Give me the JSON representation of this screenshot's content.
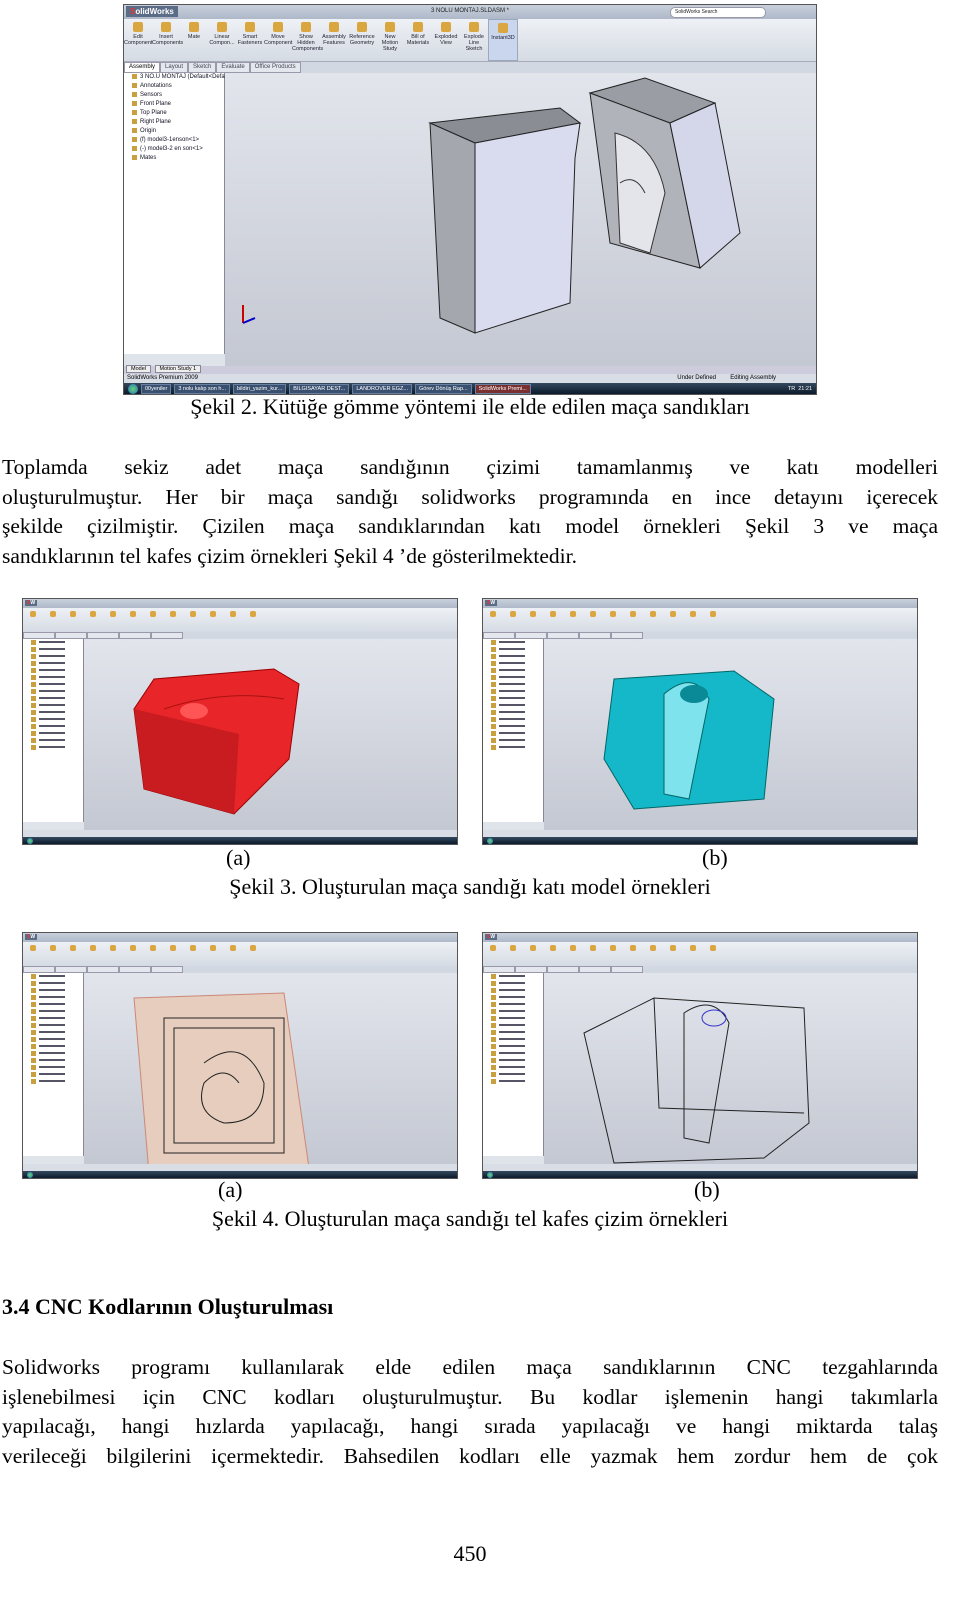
{
  "figure2": {
    "window": {
      "app_logo": "SolidWorks",
      "title": "3 NOLU MONTAJ.SLDASM *",
      "search_placeholder": "SolidWorks Search",
      "ribbon": [
        "Edit Component",
        "Insert Components",
        "Mate",
        "Linear Compon...",
        "Smart Fasteners",
        "Move Component",
        "Show Hidden Components",
        "Assembly Features",
        "Reference Geometry",
        "New Motion Study",
        "Bill of Materials",
        "Exploded View",
        "Explode Line Sketch",
        "Instant3D"
      ],
      "tabs": [
        "Assembly",
        "Layout",
        "Sketch",
        "Evaluate",
        "Office Products"
      ],
      "tree": [
        "3 NO.U MONTAJ  (Default<Defa",
        "Annotations",
        "Sensors",
        "Front Plane",
        "Top Plane",
        "Right Plane",
        "Origin",
        "(f) model3-1enson<1>",
        "(-) model3-2 en son<1>",
        "Mates"
      ],
      "bottom_tabs": [
        "Model",
        "Motion Study 1"
      ],
      "status_left": "SolidWorks Premium 2009",
      "status_right": [
        "Under Defined",
        "Editing Assembly"
      ],
      "taskbar": [
        "00yeniler",
        "3 nolu kalıp son h...",
        "bildiri_yazim_kur...",
        "BILGISAYAR DEST...",
        "LANDROVER EGZ...",
        "Görev Dönüş Rap...",
        "SolidWorks Premi..."
      ],
      "tray_lang": "TR",
      "clock": "21:21"
    },
    "caption": "Şekil 2. Kütüğe gömme yöntemi ile elde edilen maça sandıkları"
  },
  "paragraph1": {
    "lines": [
      "Toplamda sekiz adet maça sandığının çizimi tamamlanmış ve katı modelleri",
      "oluşturulmuştur. Her bir maça sandığı solidworks programında en ince detayını içerecek",
      "şekilde çizilmiştir. Çizilen maça sandıklarından katı model örnekleri Şekil 3 ve maça"
    ],
    "last_line": "sandıklarının tel kafes çizim örnekleri Şekil 4 ’de gösterilmektedir."
  },
  "figure3": {
    "label_a": "(a)",
    "label_b": "(b)",
    "caption": "Şekil 3. Oluşturulan maça sandığı katı model örnekleri",
    "colors": {
      "a": "#e8262a",
      "b": "#14b8c8"
    }
  },
  "figure4": {
    "label_a": "(a)",
    "label_b": "(b)",
    "caption": "Şekil 4. Oluşturulan maça sandığı tel kafes çizim örnekleri"
  },
  "section": {
    "heading": "3.4 CNC Kodlarının Oluşturulması"
  },
  "paragraph2": {
    "lines": [
      "Solidworks programı kullanılarak elde edilen maça sandıklarının CNC tezgahlarında",
      "işlenebilmesi için CNC kodları oluşturulmuştur. Bu kodlar işlemenin hangi takımlarla",
      "yapılacağı, hangi hızlarda yapılacağı, hangi sırada yapılacağı ve hangi miktarda talaş",
      "verileceği bilgilerini içermektedir. Bahsedilen kodları elle yazmak hem zordur hem de çok"
    ]
  },
  "page_number": "450"
}
